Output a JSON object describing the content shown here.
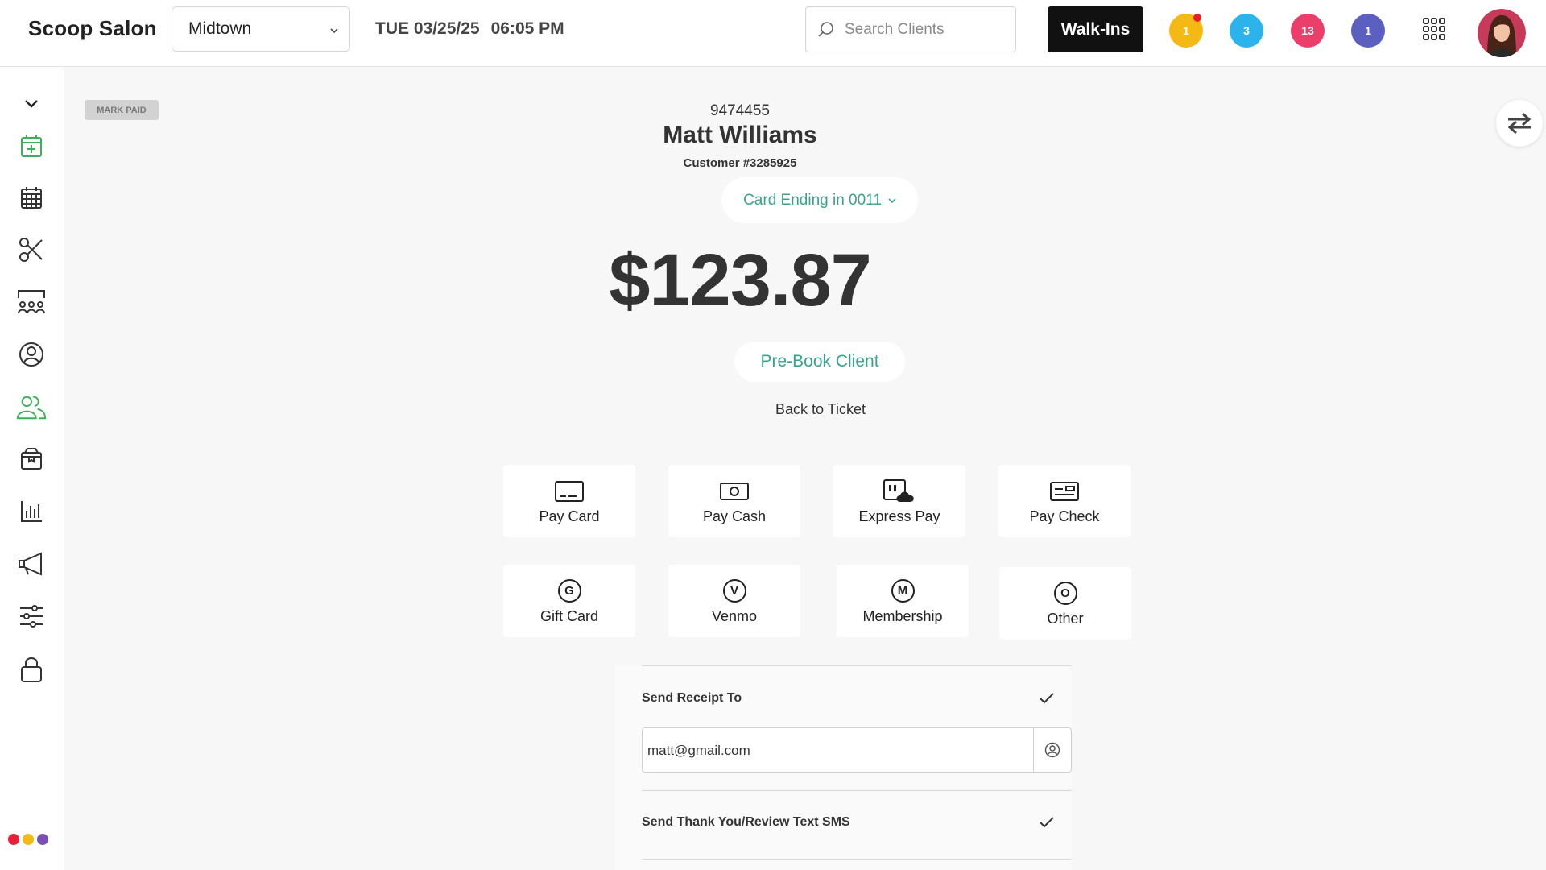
{
  "header": {
    "brand": "Scoop Salon",
    "location": "Midtown",
    "date": "TUE 03/25/25",
    "time": "06:05 PM",
    "search_placeholder": "Search Clients",
    "walkins_label": "Walk-Ins",
    "badges": [
      {
        "count": "1",
        "color": "#f5b915"
      },
      {
        "count": "3",
        "color": "#2db3ec"
      },
      {
        "count": "13",
        "color": "#ea3f6a"
      },
      {
        "count": "1",
        "color": "#5b5fc0"
      }
    ]
  },
  "sidebar": {
    "icons": [
      "chevron-down-icon",
      "calendar-add-icon",
      "calendar-grid-icon",
      "scissors-icon",
      "staff-group-icon",
      "user-circle-icon",
      "clients-icon",
      "product-box-icon",
      "bar-chart-icon",
      "megaphone-icon",
      "sliders-icon",
      "lock-icon"
    ],
    "active_color": "#3fae5a",
    "dot_colors": [
      "#e8203a",
      "#f5b915",
      "#7b4fb5"
    ]
  },
  "main": {
    "mark_paid_label": "MARK PAID",
    "ticket_id": "9474455",
    "client_name": "Matt Williams",
    "customer_number": "Customer #3285925",
    "card_label": "Card Ending in 0011",
    "amount": "$123.87",
    "prebook_label": "Pre-Book Client",
    "back_label": "Back to Ticket",
    "accent_color": "#3aa38f",
    "payment_options": [
      {
        "label": "Pay Card",
        "icon": "card-icon"
      },
      {
        "label": "Pay Cash",
        "icon": "cash-icon"
      },
      {
        "label": "Express Pay",
        "icon": "express-pay-icon"
      },
      {
        "label": "Pay Check",
        "icon": "check-icon"
      },
      {
        "label": "Gift Card",
        "icon": "G"
      },
      {
        "label": "Venmo",
        "icon": "V"
      },
      {
        "label": "Membership",
        "icon": "M"
      },
      {
        "label": "Other",
        "icon": "O"
      }
    ],
    "receipt": {
      "send_receipt_label": "Send Receipt To",
      "email_value": "matt@gmail.com",
      "sms_label": "Send Thank You/Review Text SMS"
    }
  }
}
